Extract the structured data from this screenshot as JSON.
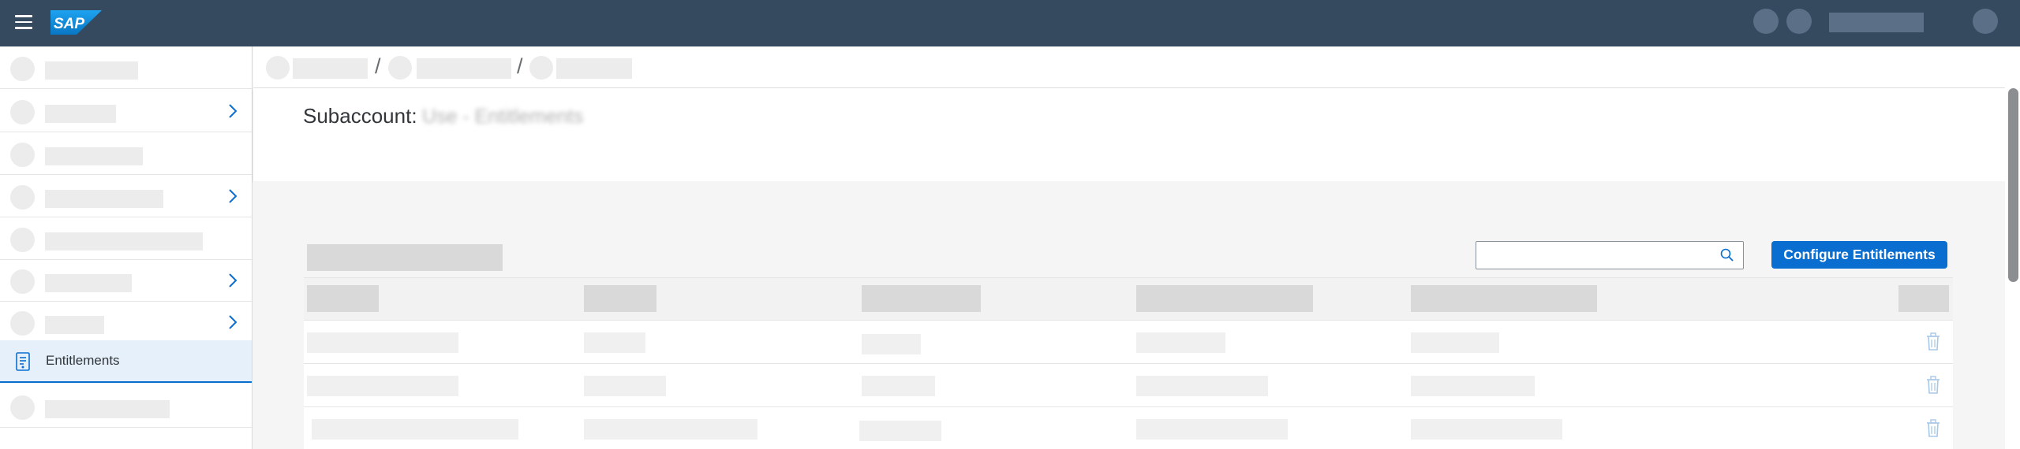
{
  "app": {
    "logo_text": "SAP",
    "brand_color": "#354a5f",
    "accent_color": "#0a6ed1"
  },
  "shell": {
    "menu_icon": "hamburger-icon",
    "right_controls": [
      "avatar-placeholder",
      "avatar-placeholder",
      "user-name-placeholder",
      "profile-avatar"
    ]
  },
  "sidebar": {
    "items": [
      {
        "label": "",
        "has_submenu": false
      },
      {
        "label": "",
        "has_submenu": true
      },
      {
        "label": "",
        "has_submenu": false
      },
      {
        "label": "",
        "has_submenu": true
      },
      {
        "label": "",
        "has_submenu": false
      },
      {
        "label": "",
        "has_submenu": true
      },
      {
        "label": "",
        "has_submenu": true
      },
      {
        "label": "Entitlements",
        "has_submenu": false,
        "selected": true,
        "icon": "entitlements-icon"
      },
      {
        "label": "",
        "has_submenu": false
      }
    ]
  },
  "breadcrumb": {
    "separator": "/"
  },
  "header": {
    "title_label": "Subaccount:",
    "title_value": "Use - Entitlements"
  },
  "toolbar": {
    "search_placeholder": "",
    "search_icon": "search-icon",
    "configure_button_label": "Configure Entitlements"
  },
  "table": {
    "row_action_icon": "delete-icon",
    "row_count": 3
  }
}
